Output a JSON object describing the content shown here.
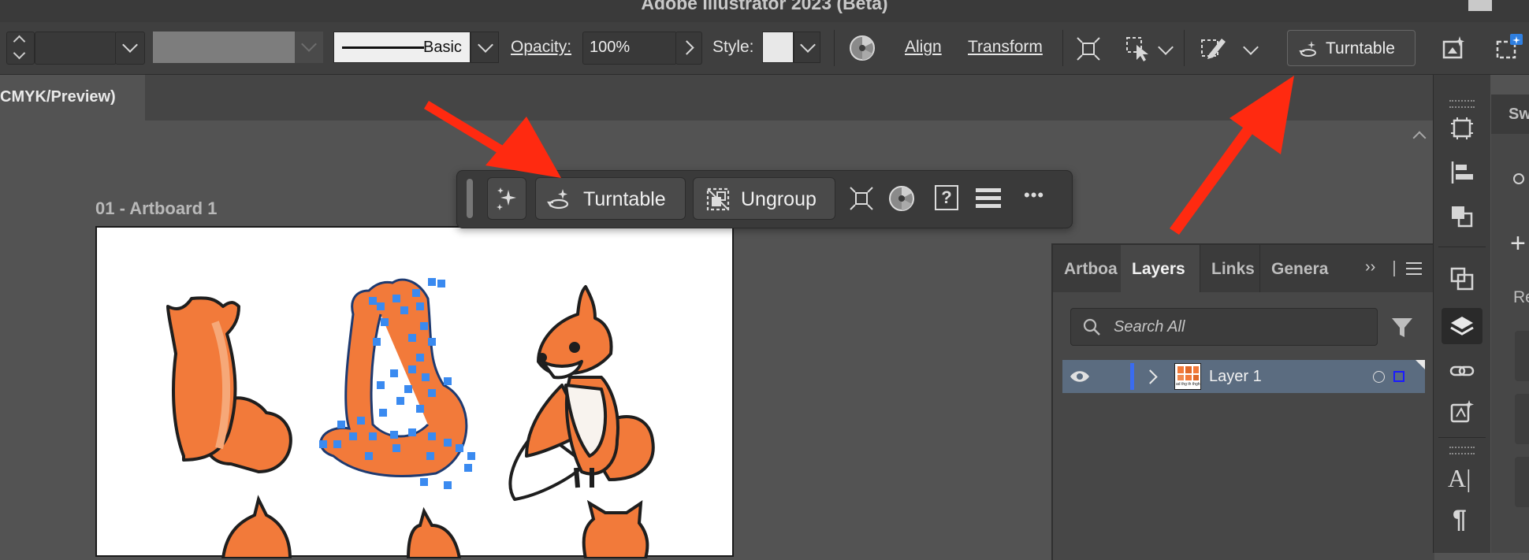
{
  "app": {
    "title": "Adobe Illustrator 2023 (Beta)"
  },
  "control_bar": {
    "stroke_style": "Basic",
    "opacity_label": "Opacity:",
    "opacity_value": "100%",
    "style_label": "Style:",
    "align_label": "Align",
    "transform_label": "Transform",
    "turntable_label": "Turntable"
  },
  "document": {
    "tab_label": "CMYK/Preview)"
  },
  "canvas": {
    "artboard_label": "01 - Artboard 1"
  },
  "contextual_task_bar": {
    "turntable_label": "Turntable",
    "ungroup_label": "Ungroup",
    "help_label": "?",
    "more_label": "•••"
  },
  "layers_panel": {
    "tabs": [
      "Artboa",
      "Layers",
      "Links",
      "Genera"
    ],
    "active_tab": "Layers",
    "search_placeholder": "Search All",
    "layer_name": "Layer 1",
    "thumb_caption": "ad thg th thgh"
  },
  "right_panel": {
    "tab_label": "Sw",
    "r_label": "Re"
  },
  "colors": {
    "annotation_arrow": "#ff2a10",
    "selection": "#3a8af0",
    "fox_orange": "#f27a3a"
  },
  "icons": [
    "stepper-icon",
    "chevron-down-icon",
    "chevron-right-icon",
    "color-wheel-icon",
    "transform-icon",
    "select-icon",
    "pen-icon",
    "turntable-icon",
    "generative-icon",
    "sparkle-icon",
    "ungroup-icon",
    "help-icon",
    "menu-icon",
    "more-icon",
    "eye-icon",
    "search-icon",
    "filter-icon",
    "artboard-tool-icon",
    "align-tool-icon",
    "pathfinder-icon",
    "layers-icon",
    "links-icon",
    "character-icon",
    "paragraph-icon"
  ]
}
